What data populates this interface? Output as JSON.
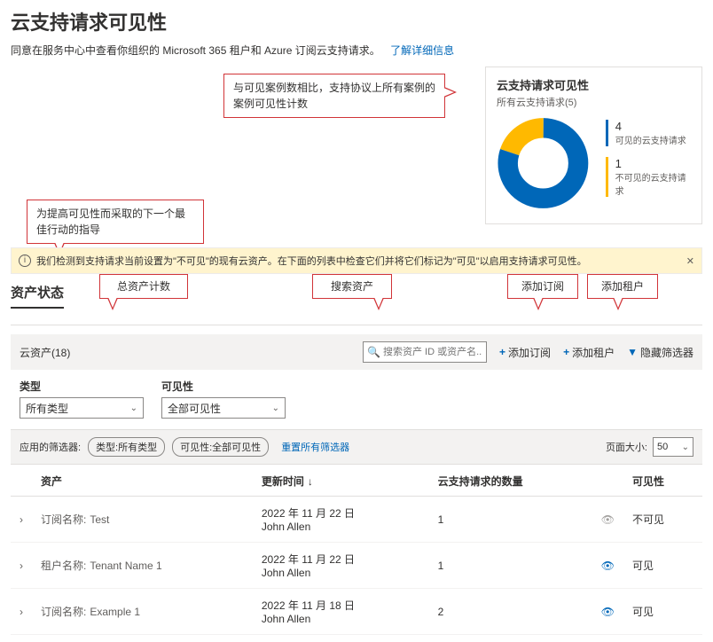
{
  "page": {
    "title": "云支持请求可见性",
    "subtitle": "同意在服务中心中查看你组织的 Microsoft 365 租户和 Azure 订阅云支持请求。",
    "learn_more": "了解详细信息"
  },
  "callouts": {
    "c1": "与可见案例数相比，支持协议上所有案例的案例可见性计数",
    "c2": "为提高可见性而采取的下一个最佳行动的指导",
    "c3": "总资产计数",
    "c4": "搜索资产",
    "c5": "添加订阅",
    "c6": "添加租户"
  },
  "card": {
    "title": "云支持请求可见性",
    "subtitle": "所有云支持请求(5)",
    "legend": [
      {
        "value": "4",
        "label": "可见的云支持请求",
        "color": "#0067b8"
      },
      {
        "value": "1",
        "label": "不可见的云支持请求",
        "color": "#ffb900"
      }
    ]
  },
  "chart_data": {
    "type": "pie",
    "title": "云支持请求可见性",
    "series": [
      {
        "name": "可见的云支持请求",
        "value": 4,
        "color": "#0067b8"
      },
      {
        "name": "不可见的云支持请求",
        "value": 1,
        "color": "#ffb900"
      }
    ],
    "total": 5
  },
  "banner": {
    "text": "我们检测到支持请求当前设置为\"不可见\"的现有云资产。在下面的列表中检查它们并将它们标记为\"可见\"以启用支持请求可见性。"
  },
  "section_title": "资产状态",
  "toolbar": {
    "assets_label": "云资产(18)",
    "search_placeholder": "搜索资产 ID 或资产名...",
    "add_subscription": "添加订阅",
    "add_tenant": "添加租户",
    "hide_filters": "隐藏筛选器"
  },
  "filters": {
    "type_label": "类型",
    "type_value": "所有类型",
    "vis_label": "可见性",
    "vis_value": "全部可见性"
  },
  "applied": {
    "label": "应用的筛选器:",
    "chip_type": "类型:所有类型",
    "chip_vis": "可见性:全部可见性",
    "reset": "重置所有筛选器",
    "page_size_label": "页面大小:",
    "page_size_value": "50"
  },
  "table": {
    "headers": {
      "asset": "资产",
      "updated": "更新时间",
      "count": "云支持请求的数量",
      "visibility": "可见性"
    },
    "rows": [
      {
        "type_label": "订阅名称:",
        "name": "Test",
        "updated_line1": "2022 年 11 月 22 日",
        "updated_line2": "John Allen",
        "count": "1",
        "visibility": "不可见",
        "visible": false
      },
      {
        "type_label": "租户名称:",
        "name": "Tenant Name 1",
        "updated_line1": "2022 年 11 月 22 日",
        "updated_line2": "John Allen",
        "count": "1",
        "visibility": "可见",
        "visible": true
      },
      {
        "type_label": "订阅名称:",
        "name": "Example 1",
        "updated_line1": "2022 年 11 月 18 日",
        "updated_line2": "John Allen",
        "count": "2",
        "visibility": "可见",
        "visible": true
      }
    ]
  }
}
